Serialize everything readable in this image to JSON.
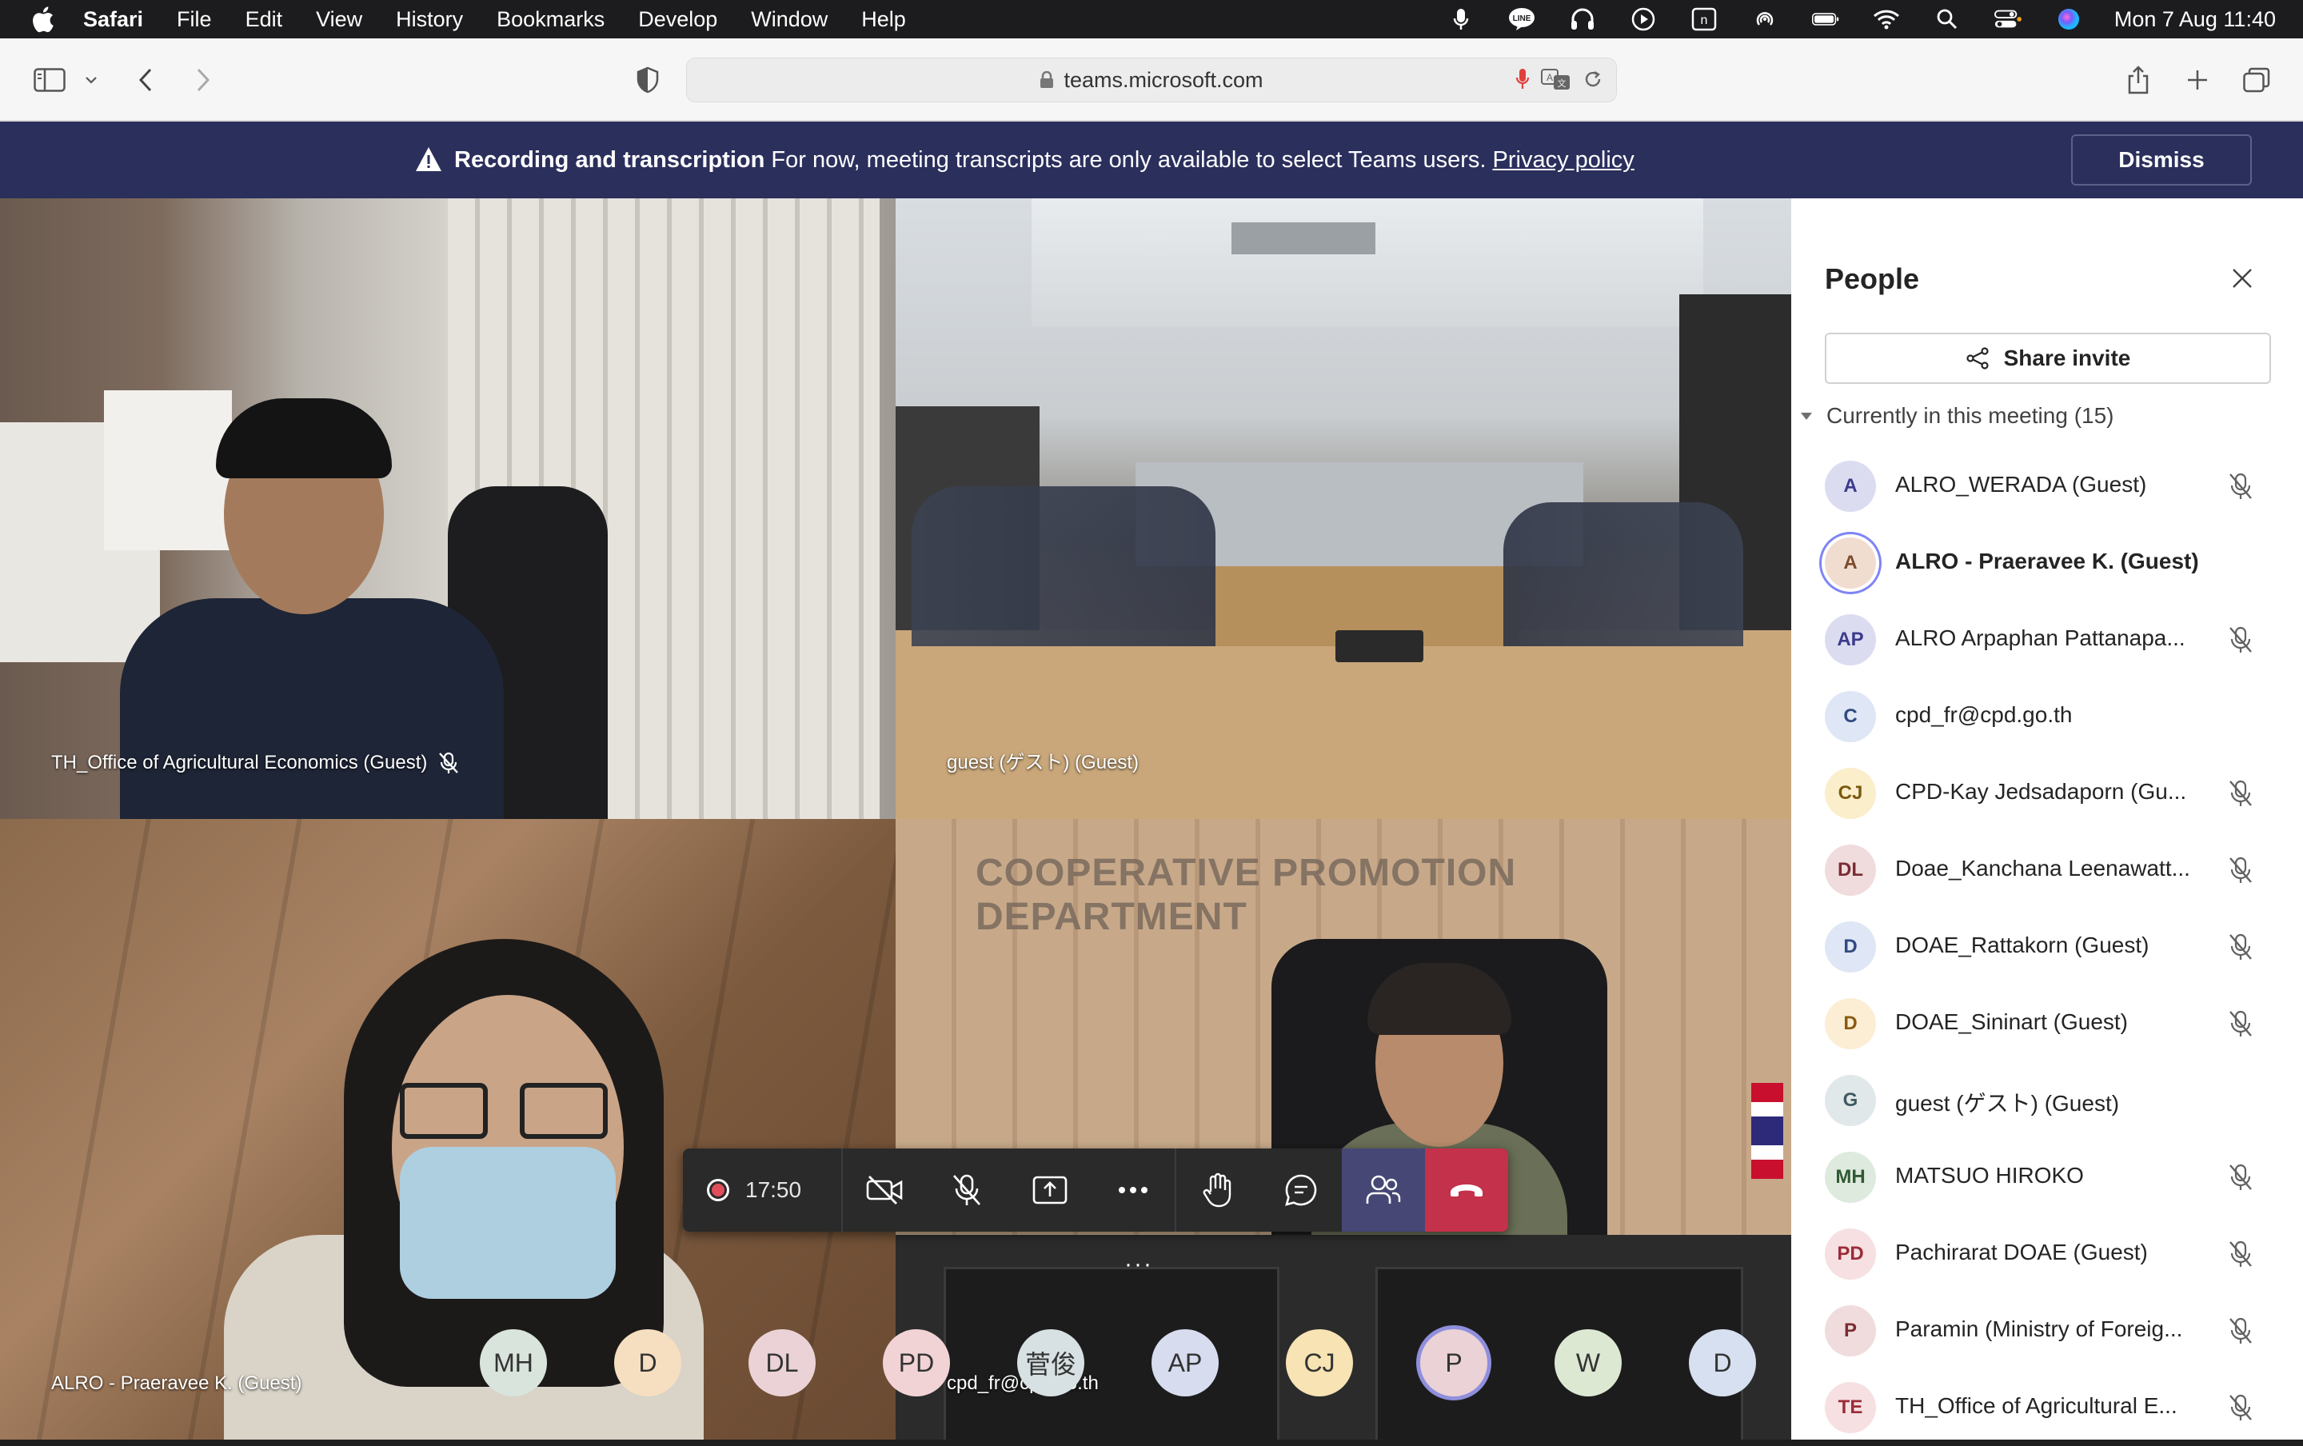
{
  "menubar": {
    "app": "Safari",
    "menus": [
      "File",
      "Edit",
      "View",
      "History",
      "Bookmarks",
      "Develop",
      "Window",
      "Help"
    ],
    "clock": "Mon 7 Aug  11:40"
  },
  "browser": {
    "url": "teams.microsoft.com"
  },
  "banner": {
    "title": "Recording and transcription",
    "message": "For now, meeting transcripts are only available to select Teams users.",
    "link": "Privacy policy",
    "dismiss": "Dismiss"
  },
  "tiles": [
    {
      "name": "TH_Office of Agricultural Economics (Guest)",
      "muted": true
    },
    {
      "name": "guest (ゲスト) (Guest)",
      "muted": false
    },
    {
      "name": "ALRO - Praeravee K. (Guest)",
      "muted": false
    },
    {
      "name": "cpd_fr@cpd.go.th",
      "muted": false
    }
  ],
  "controls": {
    "timer": "17:50",
    "more": "···"
  },
  "avatar_strip": [
    {
      "initials": "MH",
      "color": "#d8e4dc"
    },
    {
      "initials": "D",
      "color": "#f6dfc0"
    },
    {
      "initials": "DL",
      "color": "#ead2d6"
    },
    {
      "initials": "PD",
      "color": "#f1d3d6"
    },
    {
      "initials": "菅俊",
      "color": "#d7e0e2"
    },
    {
      "initials": "AP",
      "color": "#d8dcef"
    },
    {
      "initials": "CJ",
      "color": "#f7e3b3"
    },
    {
      "initials": "P",
      "color": "#ead2d6"
    },
    {
      "initials": "W",
      "color": "#dce8d2"
    },
    {
      "initials": "D",
      "color": "#d7e0f0"
    }
  ],
  "people": {
    "title": "People",
    "share_invite": "Share invite",
    "section": "Currently in this meeting",
    "count": "(15)",
    "members": [
      {
        "initials": "A",
        "name": "ALRO_WERADA (Guest)",
        "muted": true,
        "bg": "#dcdcf1",
        "fg": "#3b3b8c",
        "bold": false,
        "speaking": false
      },
      {
        "initials": "A",
        "name": "ALRO - Praeravee K. (Guest)",
        "muted": false,
        "bg": "#f1ddd0",
        "fg": "#7a4b2c",
        "bold": true,
        "speaking": true
      },
      {
        "initials": "AP",
        "name": "ALRO Arpaphan Pattanapa...",
        "muted": true,
        "bg": "#dcdcf1",
        "fg": "#3b3b8c",
        "bold": false,
        "speaking": false
      },
      {
        "initials": "C",
        "name": "cpd_fr@cpd.go.th",
        "muted": false,
        "bg": "#dfe6f5",
        "fg": "#2f4a80",
        "bold": false,
        "speaking": false
      },
      {
        "initials": "CJ",
        "name": "CPD-Kay Jedsadaporn (Gu...",
        "muted": true,
        "bg": "#fbeecb",
        "fg": "#7a5a10",
        "bold": false,
        "speaking": false
      },
      {
        "initials": "DL",
        "name": "Doae_Kanchana Leenawatt...",
        "muted": true,
        "bg": "#f0dcdd",
        "fg": "#7a2c33",
        "bold": false,
        "speaking": false
      },
      {
        "initials": "D",
        "name": "DOAE_Rattakorn (Guest)",
        "muted": true,
        "bg": "#dfe6f5",
        "fg": "#2f4a80",
        "bold": false,
        "speaking": false
      },
      {
        "initials": "D",
        "name": "DOAE_Sininart (Guest)",
        "muted": true,
        "bg": "#fbeed5",
        "fg": "#8a5a10",
        "bold": false,
        "speaking": false
      },
      {
        "initials": "G",
        "name": "guest (ゲスト) (Guest)",
        "muted": false,
        "bg": "#e1e8ea",
        "fg": "#3f5a60",
        "bold": false,
        "speaking": false
      },
      {
        "initials": "MH",
        "name": "MATSUO HIROKO",
        "muted": true,
        "bg": "#deeade",
        "fg": "#2f5a34",
        "bold": false,
        "speaking": false
      },
      {
        "initials": "PD",
        "name": "Pachirarat DOAE (Guest)",
        "muted": true,
        "bg": "#f6e0e1",
        "fg": "#9a2c3a",
        "bold": false,
        "speaking": false
      },
      {
        "initials": "P",
        "name": "Paramin (Ministry of Foreig...",
        "muted": true,
        "bg": "#f0dcdd",
        "fg": "#7a2c33",
        "bold": false,
        "speaking": false
      },
      {
        "initials": "TE",
        "name": "TH_Office of Agricultural E...",
        "muted": true,
        "bg": "#f6e0e1",
        "fg": "#9a2c3a",
        "bold": false,
        "speaking": false
      }
    ]
  }
}
